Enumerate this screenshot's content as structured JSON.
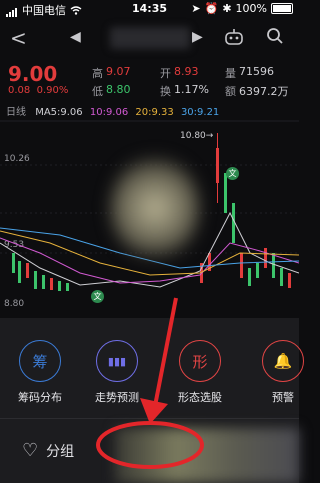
{
  "status": {
    "carrier": "中国电信",
    "time": "14:35",
    "battery": "100%"
  },
  "nav": {
    "back": "<",
    "prev": "◀",
    "next": "▶"
  },
  "quote": {
    "price": "9.00",
    "change": "0.08",
    "change_pct": "0.90%",
    "high_label": "高",
    "high": "9.07",
    "open_label": "开",
    "open": "8.93",
    "vol_label": "量",
    "vol": "71596",
    "low_label": "低",
    "low": "8.80",
    "turnover_label": "换",
    "turnover": "1.17%",
    "amount_label": "额",
    "amount": "6397.2万"
  },
  "chart": {
    "period": "日线",
    "ma5": "MA5:9.06",
    "ma10": "10:9.06",
    "ma20": "20:9.33",
    "ma30": "30:9.21",
    "ymax_label": "10.80→",
    "y_labels": [
      "10.26",
      "9.53",
      "8.80"
    ],
    "badge": "文"
  },
  "tools": [
    {
      "icon": "筹",
      "label": "筹码分布",
      "color": "#3b7bd6"
    },
    {
      "icon": "▮▮▮",
      "label": "走势预测",
      "color": "#6f6ee6"
    },
    {
      "icon": "形",
      "label": "形态选股",
      "color": "#e24545"
    },
    {
      "icon": "🔔",
      "label": "预警",
      "color": "#e24545"
    }
  ],
  "group": {
    "label": "分组"
  },
  "accent": "#e23c3c"
}
